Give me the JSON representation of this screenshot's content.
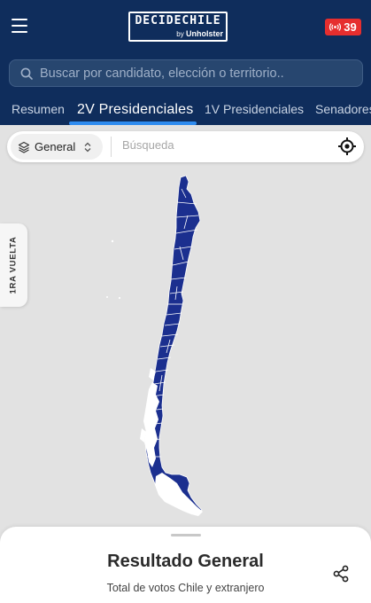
{
  "header": {
    "logo_text": "DECIDECHILE",
    "logo_by": "by",
    "logo_brand": "Unholster",
    "live_count": "39",
    "search_placeholder": "Buscar por candidato, elección o territorio..",
    "brand_color": "#0f2d5c",
    "accent_color": "#2f8cf0",
    "live_color": "#e62e2e"
  },
  "tabs": [
    {
      "label": "Resumen",
      "active": false
    },
    {
      "label": "2V Presidenciales",
      "active": true
    },
    {
      "label": "1V Presidenciales",
      "active": false
    },
    {
      "label": "Senadores",
      "active": false
    }
  ],
  "map_bar": {
    "filter_label": "General",
    "search_placeholder": "Búsqueda"
  },
  "side_tab": {
    "label": "1RA VUELTA"
  },
  "map": {
    "fill_color": "#1b2f8f",
    "remainder_color": "#ffffff",
    "icon": "chile-map"
  },
  "bottom_sheet": {
    "title": "Resultado General",
    "subtitle": "Total de votos Chile y extranjero"
  },
  "icons": [
    "menu-icon",
    "broadcast-icon",
    "search-icon",
    "layers-icon",
    "sort-icon",
    "locate-icon",
    "share-icon"
  ]
}
